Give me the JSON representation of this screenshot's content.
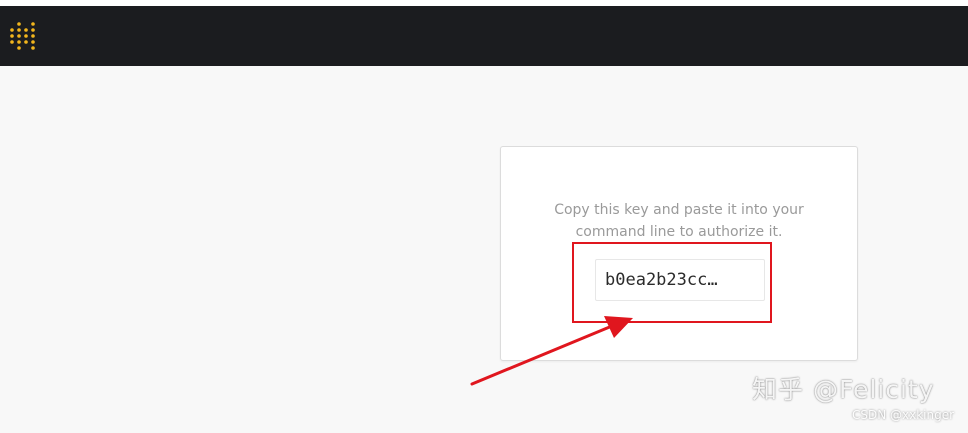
{
  "header": {
    "logo_icon": "dots-logo-icon",
    "logo_color": "#f2b51d",
    "background": "#1b1c1f"
  },
  "card": {
    "instruction_line1": "Copy this key and paste it into your",
    "instruction_line2": "command line to authorize it.",
    "api_key": "b0ea2b23cc…"
  },
  "annotation": {
    "highlight_color": "#e0161e",
    "arrow_icon": "red-arrow-icon"
  },
  "watermark": {
    "text": "知乎 @Felicity",
    "credit": "CSDN @xxkinger"
  }
}
